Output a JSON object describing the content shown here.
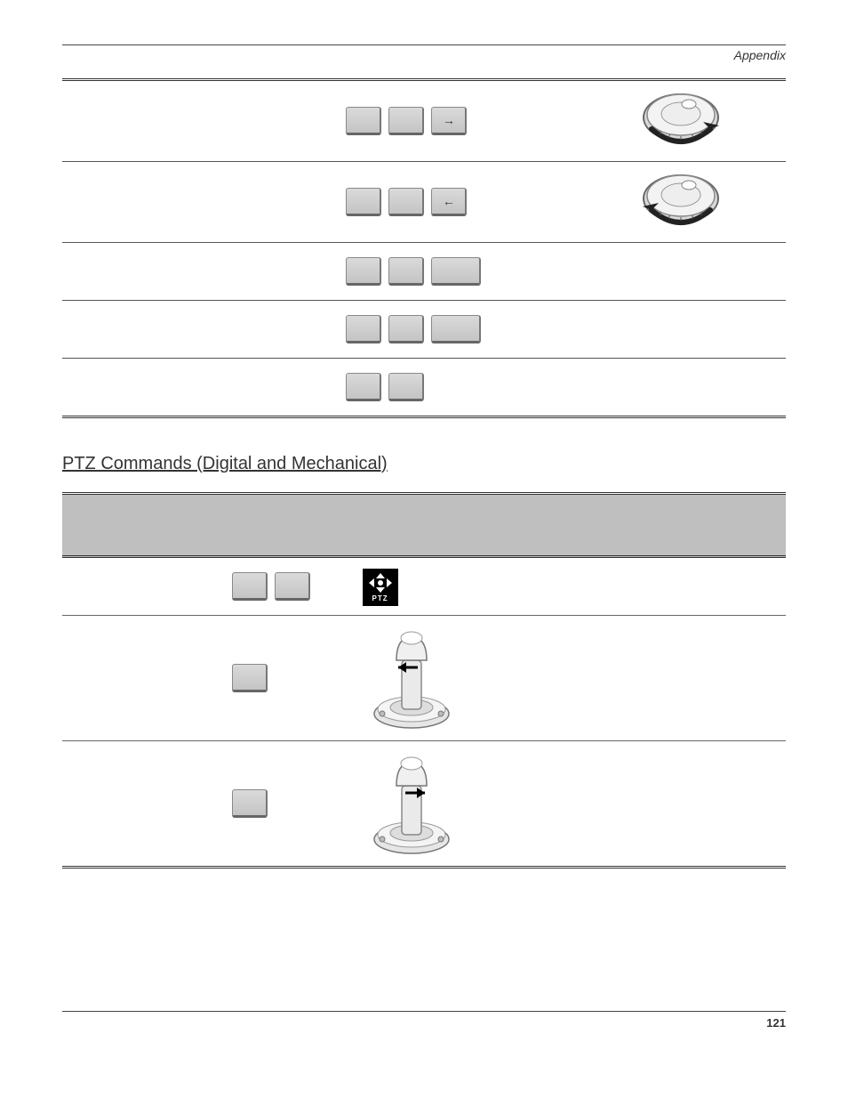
{
  "header": {
    "section": "Appendix"
  },
  "footer": {
    "page_number": "121"
  },
  "table1": {
    "rows": [
      {
        "col_a": "",
        "keys": [
          "",
          "",
          "→"
        ],
        "dial": "cw"
      },
      {
        "col_a": "",
        "keys": [
          "",
          "",
          "←"
        ],
        "dial": "ccw"
      },
      {
        "col_a": "",
        "keys": [
          "",
          "",
          ""
        ],
        "dial": null,
        "wide_last": true
      },
      {
        "col_a": "",
        "keys": [
          "",
          "",
          ""
        ],
        "dial": null,
        "wide_last": true
      },
      {
        "col_a": "",
        "keys": [
          "",
          ""
        ],
        "dial": null
      }
    ]
  },
  "section_title": "PTZ Commands (Digital and Mechanical)",
  "table2": {
    "header": {
      "a": "",
      "b": "",
      "c": ""
    },
    "rows": [
      {
        "a": "",
        "b_keys": [
          "",
          ""
        ],
        "c_type": "ptz_icon",
        "ptz_label": "PTZ"
      },
      {
        "a": "",
        "b_keys": [
          ""
        ],
        "c_type": "joy_left"
      },
      {
        "a": "",
        "b_keys": [
          ""
        ],
        "c_type": "joy_right"
      }
    ]
  },
  "icons": {
    "arrow_right": "→",
    "arrow_left": "←"
  }
}
